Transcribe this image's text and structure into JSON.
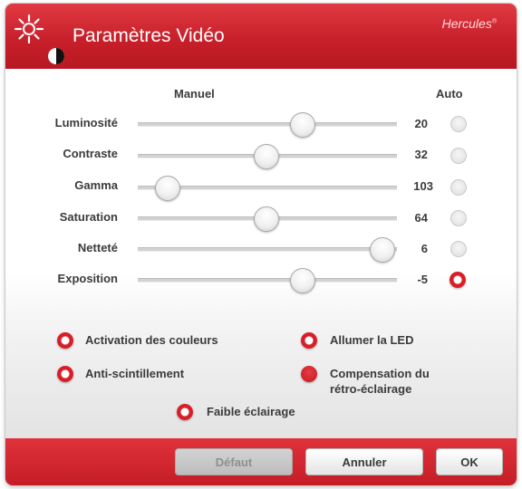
{
  "window": {
    "title": "Paramètres Vidéo",
    "brand": "Hercules",
    "brand_mark": "®"
  },
  "columns": {
    "manual": "Manuel",
    "auto": "Auto"
  },
  "sliders": [
    {
      "label": "Luminosité",
      "value": "20",
      "position_fraction": 0.66,
      "auto": false
    },
    {
      "label": "Contraste",
      "value": "32",
      "position_fraction": 0.5,
      "auto": false
    },
    {
      "label": "Gamma",
      "value": "103",
      "position_fraction": 0.11,
      "auto": false
    },
    {
      "label": "Saturation",
      "value": "64",
      "position_fraction": 0.5,
      "auto": false
    },
    {
      "label": "Netteté",
      "value": "6",
      "position_fraction": 0.94,
      "auto": false
    },
    {
      "label": "Exposition",
      "value": "-5",
      "position_fraction": 0.66,
      "auto": true
    }
  ],
  "options": [
    {
      "label": "Activation des couleurs",
      "state": "on"
    },
    {
      "label": "Allumer la LED",
      "state": "on"
    },
    {
      "label": "Anti-scintillement",
      "state": "on"
    },
    {
      "label_line1": "Compensation du",
      "label_line2": "rétro-éclairage",
      "state": "filled"
    },
    {
      "label": "Faible éclairage",
      "state": "on"
    }
  ],
  "buttons": {
    "default": "Défaut",
    "cancel": "Annuler",
    "ok": "OK"
  },
  "colors": {
    "accent": "#d81e28",
    "header": "#c8202a",
    "text": "#3b3b3b"
  }
}
